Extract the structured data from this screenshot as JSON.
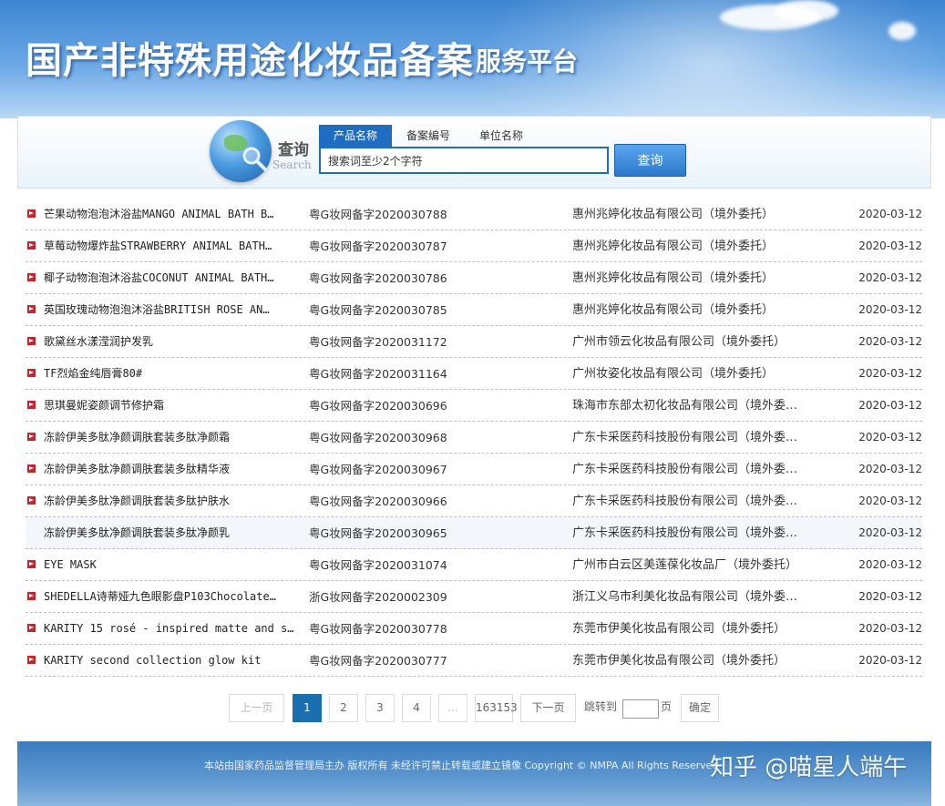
{
  "header": {
    "title": "国产非特殊用途化妆品备案",
    "subtitle": "服务平台"
  },
  "search": {
    "label": "查询",
    "label_en": "Search",
    "tabs": [
      {
        "label": "产品名称",
        "active": true
      },
      {
        "label": "备案编号",
        "active": false
      },
      {
        "label": "单位名称",
        "active": false
      }
    ],
    "input_value": "搜索词至少2个字符",
    "button_label": "查询"
  },
  "results": [
    {
      "name": "芒果动物泡泡沐浴盐MANGO ANIMAL BATH B…",
      "no": "粤G妆网备字2020030788",
      "company": "惠州兆婷化妆品有限公司（境外委托）",
      "date": "2020-03-12"
    },
    {
      "name": "草莓动物爆炸盐STRAWBERRY ANIMAL BATH…",
      "no": "粤G妆网备字2020030787",
      "company": "惠州兆婷化妆品有限公司（境外委托）",
      "date": "2020-03-12"
    },
    {
      "name": "椰子动物泡泡沐浴盐COCONUT ANIMAL BATH…",
      "no": "粤G妆网备字2020030786",
      "company": "惠州兆婷化妆品有限公司（境外委托）",
      "date": "2020-03-12"
    },
    {
      "name": "英国玫瑰动物泡泡沐浴盐BRITISH ROSE AN…",
      "no": "粤G妆网备字2020030785",
      "company": "惠州兆婷化妆品有限公司（境外委托）",
      "date": "2020-03-12"
    },
    {
      "name": "歌黛丝水漾滢润护发乳",
      "no": "粤G妆网备字2020031172",
      "company": "广州市领云化妆品有限公司（境外委托）",
      "date": "2020-03-12"
    },
    {
      "name": "TF烈焰金纯唇膏80#",
      "no": "粤G妆网备字2020031164",
      "company": "广州妆姿化妆品有限公司（境外委托）",
      "date": "2020-03-12"
    },
    {
      "name": "思琪曼妮姿颜调节修护霜",
      "no": "粤G妆网备字2020030696",
      "company": "珠海市东部太初化妆品有限公司（境外委…",
      "date": "2020-03-12"
    },
    {
      "name": "冻龄伊美多肽净颜调肤套装多肽净颜霜",
      "no": "粤G妆网备字2020030968",
      "company": "广东卡采医药科技股份有限公司（境外委…",
      "date": "2020-03-12"
    },
    {
      "name": "冻龄伊美多肽净颜调肤套装多肽精华液",
      "no": "粤G妆网备字2020030967",
      "company": "广东卡采医药科技股份有限公司（境外委…",
      "date": "2020-03-12"
    },
    {
      "name": "冻龄伊美多肽净颜调肤套装多肽护肤水",
      "no": "粤G妆网备字2020030966",
      "company": "广东卡采医药科技股份有限公司（境外委…",
      "date": "2020-03-12"
    },
    {
      "name": "冻龄伊美多肽净颜调肤套装多肽净颜乳",
      "no": "粤G妆网备字2020030965",
      "company": "广东卡采医药科技股份有限公司（境外委…",
      "date": "2020-03-12"
    },
    {
      "name": "EYE MASK",
      "no": "粤G妆网备字2020031074",
      "company": "广州市白云区美莲葆化妆品厂（境外委托）",
      "date": "2020-03-12"
    },
    {
      "name": "SHEDELLA诗蒂娅九色眼影盘P103Chocolate…",
      "no": "浙G妆网备字2020002309",
      "company": "浙江义乌市利美化妆品有限公司（境外委…",
      "date": "2020-03-12"
    },
    {
      "name": "KARITY 15 rosé - inspired matte and s…",
      "no": "粤G妆网备字2020030778",
      "company": "东莞市伊美化妆品有限公司（境外委托）",
      "date": "2020-03-12"
    },
    {
      "name": "KARITY second collection glow kit",
      "no": "粤G妆网备字2020030777",
      "company": "东莞市伊美化妆品有限公司（境外委托）",
      "date": "2020-03-12"
    }
  ],
  "pagination": {
    "prev": "上一页",
    "pages": [
      "1",
      "2",
      "3",
      "4",
      "...",
      "163153"
    ],
    "current": "1",
    "next": "下一页",
    "jump_label": "跳转到",
    "page_unit": "页",
    "confirm": "确定"
  },
  "footer": {
    "text": "本站由国家药品监督管理局主办 版权所有 未经许可禁止转载或建立镜像 Copyright © NMPA All Rights Reserved",
    "watermark": "知乎 @喵星人端午"
  },
  "colors": {
    "accent": "#1e6dc2",
    "bullet": "#c1272d",
    "current_page": "#1a6fb0"
  }
}
